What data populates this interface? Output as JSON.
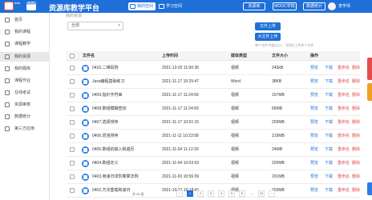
{
  "header": {
    "logo_text": "ICVE",
    "logo_seal_text": "智慧职教",
    "title": "资源库教学平台",
    "tabs": [
      {
        "label": "我的空间",
        "active": true
      },
      {
        "label": "学习空间",
        "active": false
      }
    ],
    "buttons": [
      "资源库",
      "MOOC学院",
      "数据统计"
    ],
    "user_name": "李学师"
  },
  "sidebar": {
    "items": [
      {
        "label": "首页",
        "active": false
      },
      {
        "label": "我的课程",
        "active": false
      },
      {
        "label": "课程教学",
        "active": false
      },
      {
        "label": "我的资源",
        "active": true
      },
      {
        "label": "我的题库",
        "active": false
      },
      {
        "label": "课程作业",
        "active": false
      },
      {
        "label": "在线考试",
        "active": false
      },
      {
        "label": "资源审核",
        "active": false
      },
      {
        "label": "数据统计",
        "active": false
      },
      {
        "label": "第三方应用",
        "active": false
      }
    ]
  },
  "main": {
    "breadcrumb": "我的资源",
    "select": {
      "value": "全部"
    },
    "upload_button": "文件上传",
    "batch_upload_button": "大文件上传",
    "note": "单个文件不超过2G，可同时上传多个文件",
    "columns": [
      "文件名",
      "上传时间",
      "媒体类型",
      "文件大小",
      "操作"
    ],
    "rows": [
      {
        "name": "0410.二维码例",
        "time": "2021-12-02 11:00:36",
        "type": "视频",
        "size": "243kB"
      },
      {
        "name": "Java编程基础练习",
        "time": "2021-11-17 10:25:47",
        "type": "Word",
        "size": "38KB"
      },
      {
        "name": "0409.指针字符串",
        "time": "2021-11-17 11:24:59",
        "type": "视频",
        "size": "157MB"
      },
      {
        "name": "0408.数组模糊查找",
        "time": "2021-11-17 11:24:59",
        "type": "视频",
        "size": "66MB"
      },
      {
        "name": "0407.选择排序",
        "time": "2021-11-17 10:51:15",
        "type": "视频",
        "size": "203MB"
      },
      {
        "name": "0406.冒泡排序",
        "time": "2021-11-11 10:23:58",
        "type": "视频",
        "size": "219MB"
      },
      {
        "name": "0405.数组的输入和遍历",
        "time": "2021-11-04 11:12:20",
        "type": "视频",
        "size": "24MB"
      },
      {
        "name": "0404.数组定义",
        "time": "2021-11-04 10:53:53",
        "type": "视频",
        "size": "220MB"
      },
      {
        "name": "0403.用递归求阶乘算法例",
        "time": "2021-11-03 10:56:39",
        "type": "视频",
        "size": "201MB"
      },
      {
        "name": "0402.方法重载和递归",
        "time": "2021-10-21 16:18:41",
        "type": "视频",
        "size": "203MB"
      }
    ],
    "actions": [
      "预览",
      "下载",
      "重命名",
      "删除"
    ]
  },
  "pagination": {
    "info": "共 95 条",
    "pages": [
      "1",
      "2",
      "3",
      "4",
      "5",
      "6",
      "...",
      "10"
    ],
    "current": "1",
    "prev": "‹",
    "next": "›"
  }
}
